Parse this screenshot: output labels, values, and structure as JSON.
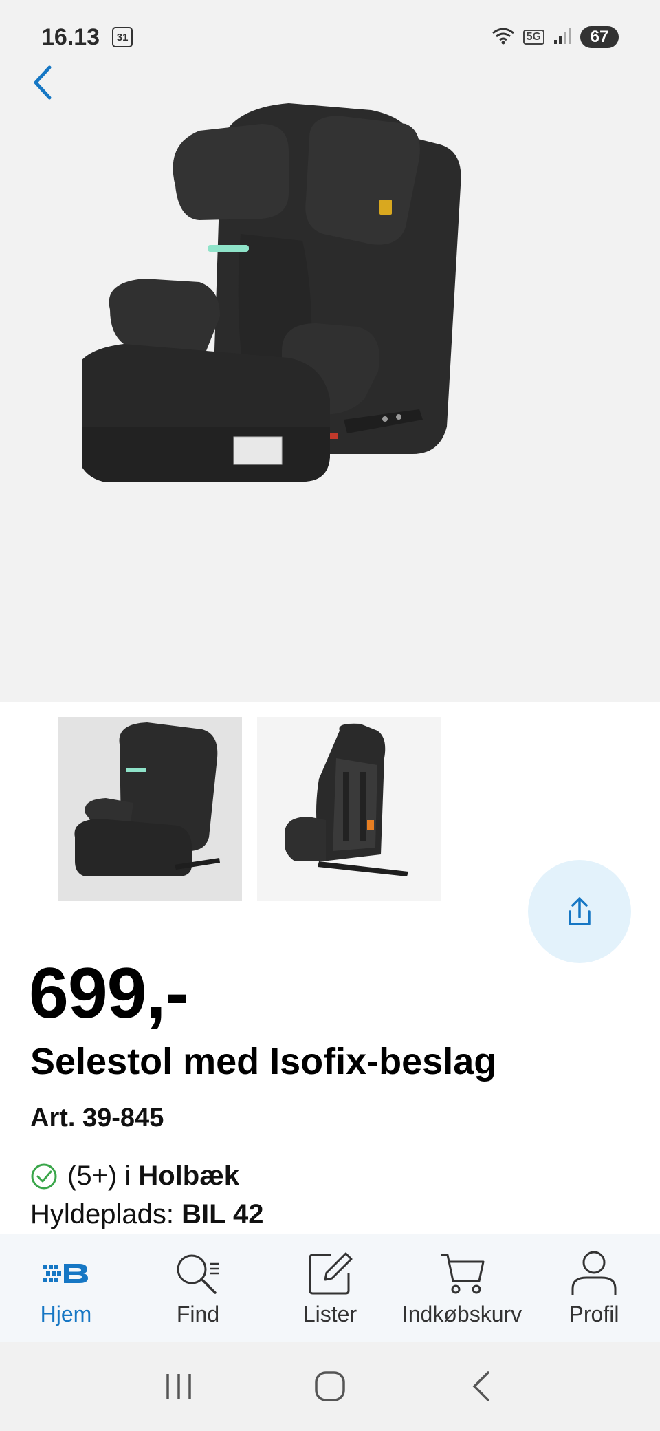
{
  "status_bar": {
    "time": "16.13",
    "calendar_day": "31",
    "network": "5G",
    "battery": "67"
  },
  "colors": {
    "accent": "#1677c4",
    "share_bg": "#e3f2fb",
    "stock_ok": "#3aa64a",
    "hero_bg": "#f2f2f2"
  },
  "product": {
    "price": "699,-",
    "title": "Selestol med Isofix-beslag",
    "article": "Art. 39-845",
    "stock_count": "(5+) i ",
    "store": "Holbæk",
    "shelf_label": "Hyldeplads: ",
    "shelf_value": "BIL 42"
  },
  "nav": {
    "items": [
      {
        "label": "Hjem",
        "icon": "home-logo-icon"
      },
      {
        "label": "Find",
        "icon": "search-icon"
      },
      {
        "label": "Lister",
        "icon": "edit-icon"
      },
      {
        "label": "Indkøbskurv",
        "icon": "cart-icon"
      },
      {
        "label": "Profil",
        "icon": "profile-icon"
      }
    ]
  }
}
